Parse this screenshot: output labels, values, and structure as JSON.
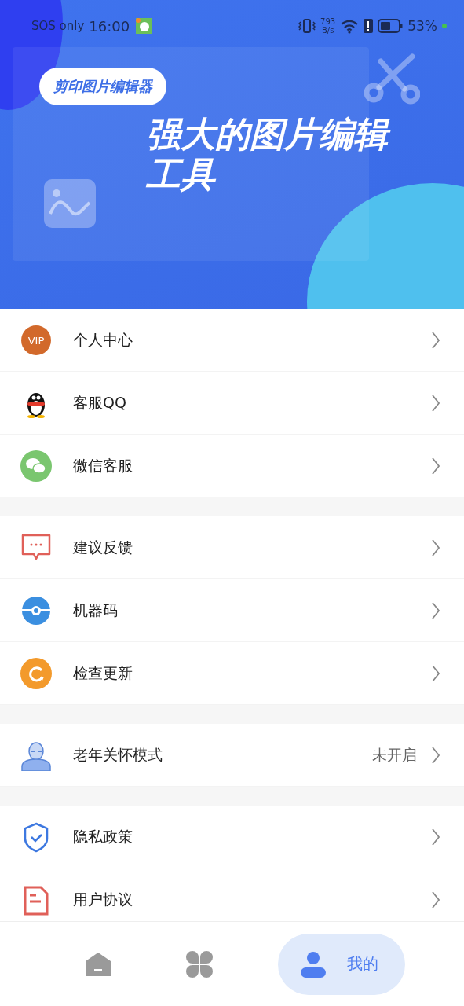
{
  "status_bar": {
    "carrier": "SOS only",
    "time": "16:00",
    "speed_value": "793",
    "speed_unit": "B/s",
    "battery": "53%"
  },
  "header": {
    "badge": "剪印图片编辑器",
    "title": "强大的图片编辑工具"
  },
  "sections": [
    {
      "items": [
        {
          "kind": "vip",
          "badge": "VIP",
          "label": "个人中心"
        },
        {
          "kind": "qq",
          "label": "客服QQ"
        },
        {
          "kind": "wechat",
          "label": "微信客服"
        }
      ]
    },
    {
      "items": [
        {
          "kind": "feedback",
          "label": "建议反馈"
        },
        {
          "kind": "code",
          "label": "机器码"
        },
        {
          "kind": "update",
          "label": "检查更新"
        }
      ]
    },
    {
      "items": [
        {
          "kind": "elder",
          "label": "老年关怀模式",
          "value": "未开启"
        }
      ]
    },
    {
      "items": [
        {
          "kind": "privacy",
          "label": "隐私政策"
        },
        {
          "kind": "agreement",
          "label": "用户协议"
        }
      ]
    }
  ],
  "bottom_nav": [
    {
      "selected": false
    },
    {
      "selected": false
    },
    {
      "label": "我的",
      "selected": true
    }
  ]
}
